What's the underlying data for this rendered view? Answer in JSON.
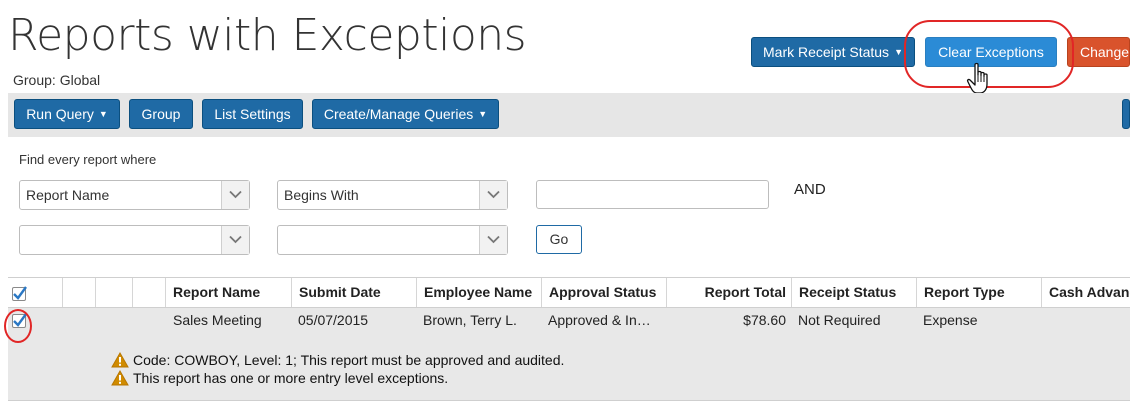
{
  "page": {
    "title": "Reports with Exceptions",
    "group_label": "Group: Global"
  },
  "actions": {
    "mark_receipt_status": "Mark Receipt Status",
    "clear_exceptions": "Clear Exceptions",
    "change": "Change"
  },
  "toolbar": {
    "run_query": "Run Query",
    "group": "Group",
    "list_settings": "List Settings",
    "create_manage_queries": "Create/Manage Queries"
  },
  "query": {
    "find_label": "Find every report where",
    "field1": "Report Name",
    "operator1": "Begins With",
    "value1": "",
    "conjunction": "AND",
    "field2": "",
    "operator2": "",
    "go_label": "Go"
  },
  "table": {
    "columns": [
      "Report Name",
      "Submit Date",
      "Employee Name",
      "Approval Status",
      "Report Total",
      "Receipt Status",
      "Report Type",
      "Cash Advance"
    ],
    "rows": [
      {
        "checked": true,
        "report_name": "Sales Meeting",
        "submit_date": "05/07/2015",
        "employee_name": "Brown, Terry L.",
        "approval_status": "Approved & In…",
        "report_total": "$78.60",
        "receipt_status": "Not Required",
        "report_type": "Expense",
        "cash_advance": ""
      }
    ],
    "exceptions": [
      "Code: COWBOY, Level: 1; This report must be approved and audited.",
      "This report has one or more entry level exceptions."
    ]
  },
  "colors": {
    "primary_button": "#1f6aa5",
    "highlight_button": "#2b8bd6",
    "change_button": "#d9532c",
    "annotation": "#e12626",
    "warning": "#d08b00"
  }
}
